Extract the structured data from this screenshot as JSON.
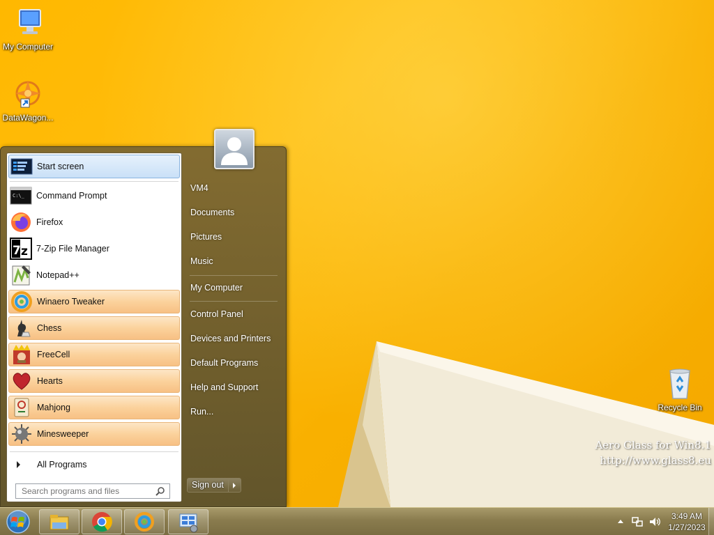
{
  "desktop": {
    "icons": [
      {
        "label": "My Computer"
      },
      {
        "label": "DataWagon..."
      },
      {
        "label": "Recycle Bin"
      }
    ],
    "watermark": {
      "line1": "Aero Glass for Win8.1",
      "line2": "http://www.glass8.eu"
    }
  },
  "start_menu": {
    "pinned": [
      {
        "label": "Start screen",
        "icon": "start-screen-icon"
      }
    ],
    "recent": [
      {
        "label": "Command Prompt",
        "icon": "command-prompt-icon"
      },
      {
        "label": "Firefox",
        "icon": "firefox-icon"
      },
      {
        "label": "7-Zip File Manager",
        "icon": "7zip-icon"
      },
      {
        "label": "Notepad++",
        "icon": "notepadpp-icon"
      },
      {
        "label": "Winaero Tweaker",
        "icon": "winaero-icon"
      },
      {
        "label": "Chess",
        "icon": "chess-icon"
      },
      {
        "label": "FreeCell",
        "icon": "freecell-icon"
      },
      {
        "label": "Hearts",
        "icon": "hearts-icon"
      },
      {
        "label": "Mahjong",
        "icon": "mahjong-icon"
      },
      {
        "label": "Minesweeper",
        "icon": "minesweeper-icon"
      }
    ],
    "all_programs": "All Programs",
    "search": {
      "placeholder": "Search programs and files"
    },
    "right": {
      "items": [
        {
          "label": "VM4"
        },
        {
          "label": "Documents"
        },
        {
          "label": "Pictures"
        },
        {
          "label": "Music"
        },
        {
          "label": "My Computer"
        },
        {
          "label": "Control Panel"
        },
        {
          "label": "Devices and Printers"
        },
        {
          "label": "Default Programs"
        },
        {
          "label": "Help and Support"
        },
        {
          "label": "Run..."
        }
      ]
    },
    "sign_out": "Sign out"
  },
  "taskbar": {
    "buttons": [
      {
        "icon": "file-explorer-icon"
      },
      {
        "icon": "chrome-icon"
      },
      {
        "icon": "winaero-icon"
      },
      {
        "icon": "control-panel-icon"
      }
    ],
    "clock": {
      "time": "3:49 AM",
      "date": "1/27/2023"
    }
  },
  "colors": {
    "wallpaper": "#ffb800",
    "highlight": "#fbd29c",
    "taskbar": "#8a7c4e"
  }
}
